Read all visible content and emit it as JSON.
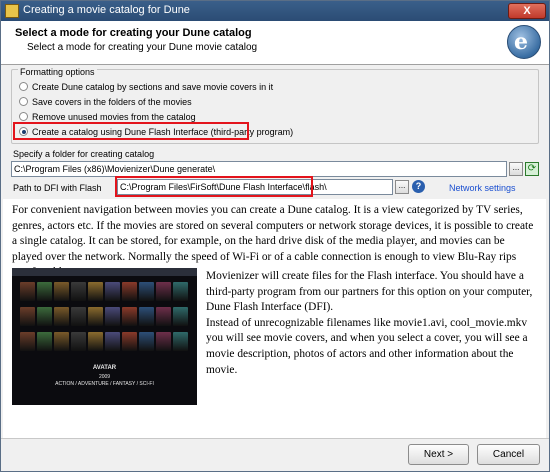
{
  "window": {
    "title": "Creating a movie catalog for Dune",
    "close_label": "X"
  },
  "header": {
    "title": "Select a mode for creating your Dune catalog",
    "subtitle": "Select a mode for creating your Dune movie catalog",
    "logo_glyph": "e"
  },
  "formatting": {
    "label": "Formatting options",
    "options": [
      {
        "label": "Create Dune catalog by sections and save movie covers in it",
        "checked": false
      },
      {
        "label": "Save covers in the folders of the movies",
        "checked": false
      },
      {
        "label": "Remove unused movies from the catalog",
        "checked": false
      },
      {
        "label": "Create a catalog using Dune Flash Interface (third-party program)",
        "checked": true
      }
    ]
  },
  "folder": {
    "label": "Specify a folder for creating catalog",
    "value": "C:\\Program Files (x86)\\Movienizer\\Dune generate\\",
    "browse_label": "...",
    "refresh_icon": "refresh-icon"
  },
  "dfi": {
    "label": "Path to DFI with Flash",
    "value": "C:\\Program Files\\FirSoft\\Dune Flash Interface\\flash\\",
    "browse_label": "...",
    "help_label": "?",
    "network_link": "Network settings"
  },
  "description": {
    "paragraph1": "For convenient navigation between movies you can create a Dune catalog. It is a view categorized by TV series, genres, actors etc. If the movies are stored on several computers or network storage devices, it is possible to create a single catalog. It can be stored, for example, on the hard drive disk of the media player, and movies can be played over the network. Normally the speed of Wi-Fi or of a cable connection is enough to view Blu-Ray rips comfortably.",
    "paragraph2": "Movienizer will create files for the Flash interface. You should have a third-party program from our partners for this option on your computer, Dune Flash Interface (DFI).\nInstead of unrecognizable filenames like movie1.avi, cool_movie.mkv you will see movie covers, and when you select a cover, you will see a movie description, photos of actors and other information about the movie.",
    "preview_title": "AVATAR",
    "preview_year": "2009",
    "preview_genres": "ACTION / ADVENTURE / FANTASY / SCI-FI"
  },
  "footer": {
    "next_label": "Next >",
    "cancel_label": "Cancel"
  },
  "colors": {
    "title_bar": "#2b4c74",
    "highlight_box": "#e3141c",
    "link": "#1a4fd0"
  }
}
